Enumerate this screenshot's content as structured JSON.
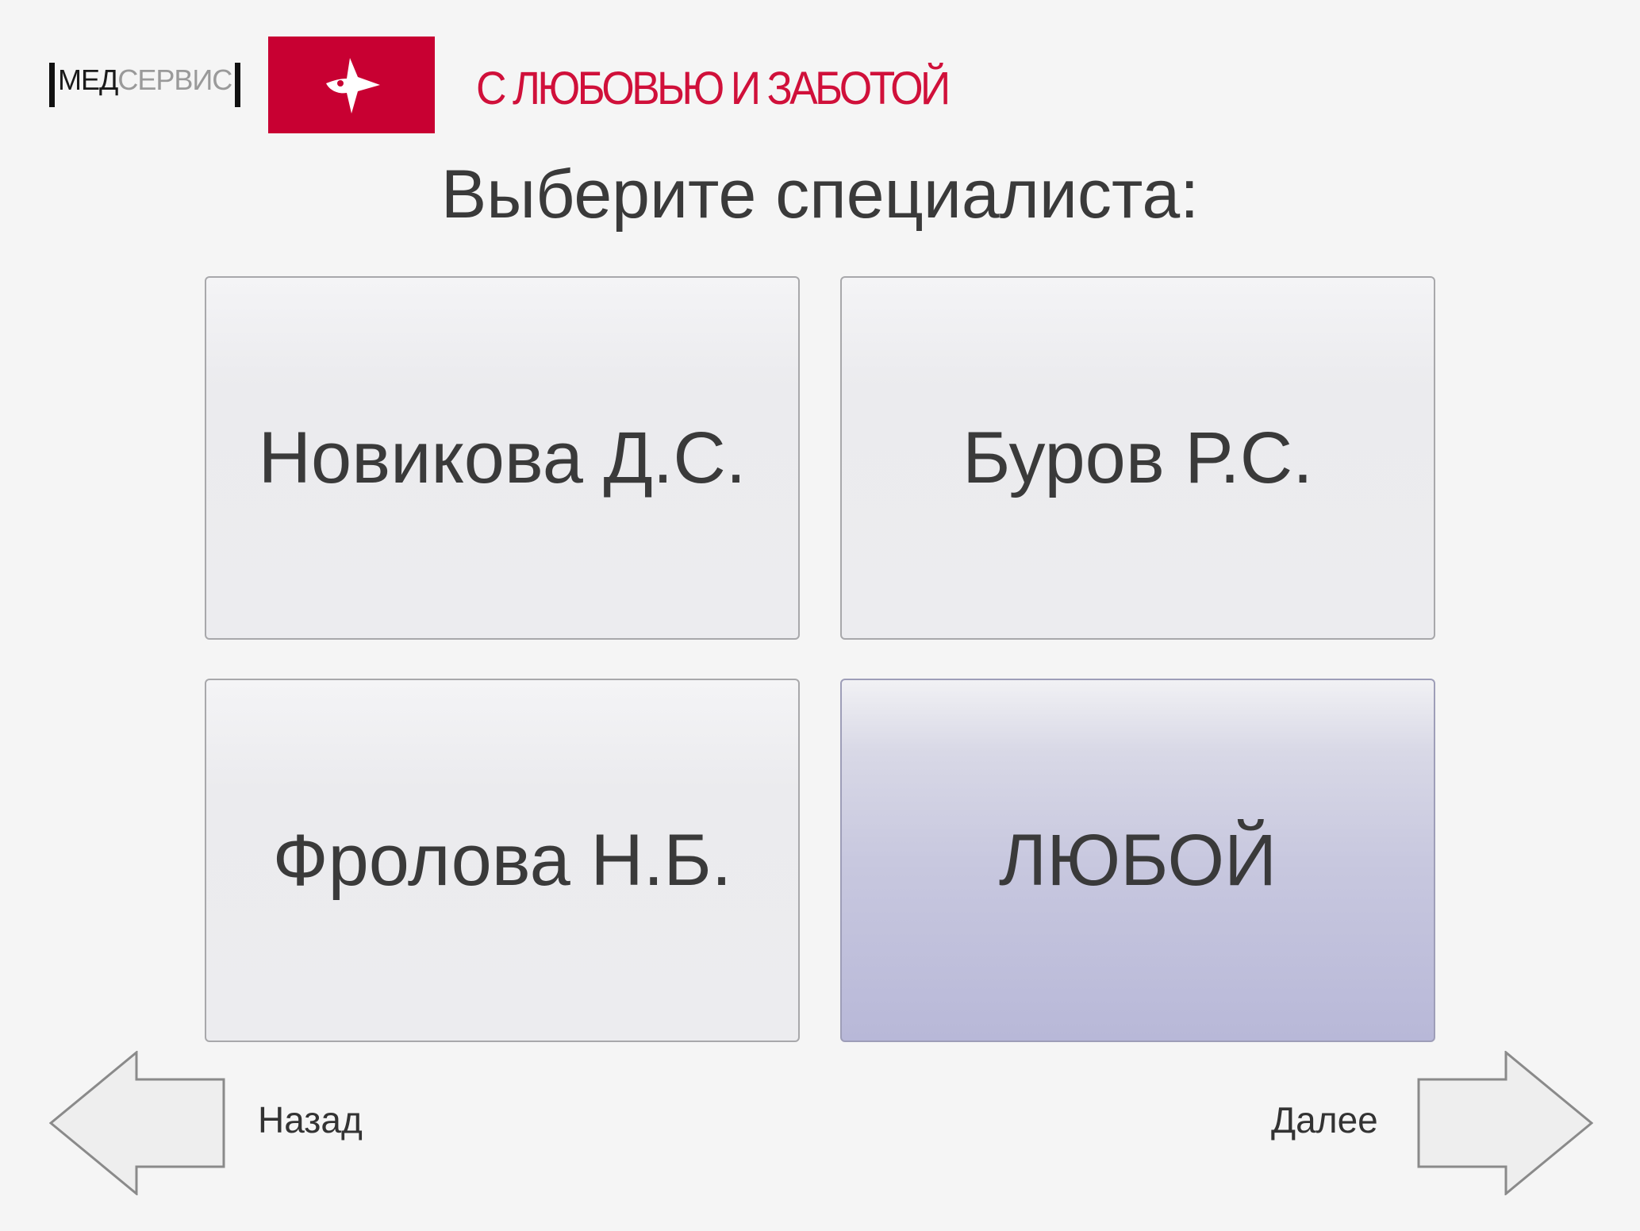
{
  "header": {
    "logo": {
      "part1": "МЕД",
      "part2": "СЕРВИС"
    },
    "slogan": "С ЛЮБОВЬЮ И ЗАБОТОЙ",
    "brand_color": "#c80032"
  },
  "main": {
    "title": "Выберите специалиста:",
    "options": [
      {
        "label": "Новикова Д.С.",
        "selected": false
      },
      {
        "label": "Буров Р.С.",
        "selected": false
      },
      {
        "label": "Фролова Н.Б.",
        "selected": false
      },
      {
        "label": "ЛЮБОЙ",
        "selected": true
      }
    ]
  },
  "footer": {
    "back_label": "Назад",
    "next_label": "Далее"
  },
  "icons": {
    "back": "arrow-left-icon",
    "next": "arrow-right-icon",
    "logo": "bird-logo-icon"
  }
}
